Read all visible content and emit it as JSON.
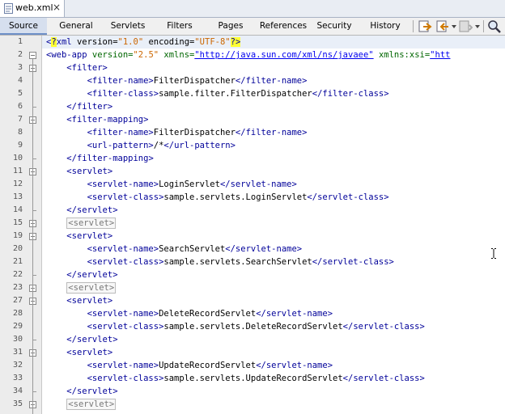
{
  "file_tab": {
    "name": "web.xml",
    "close": "×"
  },
  "view_tabs": [
    "Source",
    "General",
    "Servlets",
    "Filters",
    "Pages",
    "References",
    "Security",
    "History"
  ],
  "active_tab": "Source",
  "toolbar_icons": [
    "back-icon",
    "forward-icon",
    "dropdown-icon",
    "find-icon"
  ],
  "code_lines": [
    {
      "n": "1",
      "s": [
        [
          "t",
          "<"
        ],
        [
          "t y",
          "?"
        ],
        [
          "t",
          "xml"
        ],
        [
          "x",
          " version="
        ],
        [
          "v",
          "\"1.0\""
        ],
        [
          "x",
          " encoding="
        ],
        [
          "v",
          "\"UTF-8\""
        ],
        [
          "t y",
          "?>"
        ]
      ]
    },
    {
      "n": "2",
      "s": [
        [
          "t",
          "<web-app"
        ],
        [
          "a",
          " version="
        ],
        [
          "v",
          "\"2.5\""
        ],
        [
          "a",
          " xmlns="
        ],
        [
          "u",
          "\"http://java.sun.com/xml/ns/javaee\""
        ],
        [
          "a",
          " xmlns:xsi="
        ],
        [
          "u",
          "\"htt"
        ]
      ]
    },
    {
      "n": "3",
      "s": [
        [
          "x",
          "    "
        ],
        [
          "t",
          "<filter>"
        ]
      ]
    },
    {
      "n": "4",
      "s": [
        [
          "x",
          "        "
        ],
        [
          "t",
          "<filter-name>"
        ],
        [
          "x",
          "FilterDispatcher"
        ],
        [
          "t",
          "</filter-name>"
        ]
      ]
    },
    {
      "n": "5",
      "s": [
        [
          "x",
          "        "
        ],
        [
          "t",
          "<filter-class>"
        ],
        [
          "x",
          "sample.filter.FilterDispatcher"
        ],
        [
          "t",
          "</filter-class>"
        ]
      ]
    },
    {
      "n": "6",
      "s": [
        [
          "x",
          "    "
        ],
        [
          "t",
          "</filter>"
        ]
      ]
    },
    {
      "n": "7",
      "s": [
        [
          "x",
          "    "
        ],
        [
          "t",
          "<filter-mapping>"
        ]
      ]
    },
    {
      "n": "8",
      "s": [
        [
          "x",
          "        "
        ],
        [
          "t",
          "<filter-name>"
        ],
        [
          "x",
          "FilterDispatcher"
        ],
        [
          "t",
          "</filter-name>"
        ]
      ]
    },
    {
      "n": "9",
      "s": [
        [
          "x",
          "        "
        ],
        [
          "t",
          "<url-pattern>"
        ],
        [
          "x",
          "/*"
        ],
        [
          "t",
          "</url-pattern>"
        ]
      ]
    },
    {
      "n": "10",
      "s": [
        [
          "x",
          "    "
        ],
        [
          "t",
          "</filter-mapping>"
        ]
      ]
    },
    {
      "n": "11",
      "s": [
        [
          "x",
          "    "
        ],
        [
          "t",
          "<servlet>"
        ]
      ]
    },
    {
      "n": "12",
      "s": [
        [
          "x",
          "        "
        ],
        [
          "t",
          "<servlet-name>"
        ],
        [
          "x",
          "LoginServlet"
        ],
        [
          "t",
          "</servlet-name>"
        ]
      ]
    },
    {
      "n": "13",
      "s": [
        [
          "x",
          "        "
        ],
        [
          "t",
          "<servlet-class>"
        ],
        [
          "x",
          "sample.servlets.LoginServlet"
        ],
        [
          "t",
          "</servlet-class>"
        ]
      ]
    },
    {
      "n": "14",
      "s": [
        [
          "x",
          "    "
        ],
        [
          "t",
          "</servlet>"
        ]
      ]
    },
    {
      "n": "15",
      "s": [
        [
          "x",
          "    "
        ],
        [
          "fb",
          "<servlet>"
        ]
      ]
    },
    {
      "n": "19",
      "s": [
        [
          "x",
          "    "
        ],
        [
          "t",
          "<servlet>"
        ]
      ]
    },
    {
      "n": "20",
      "s": [
        [
          "x",
          "        "
        ],
        [
          "t",
          "<servlet-name>"
        ],
        [
          "x",
          "SearchServlet"
        ],
        [
          "t",
          "</servlet-name>"
        ]
      ]
    },
    {
      "n": "21",
      "s": [
        [
          "x",
          "        "
        ],
        [
          "t",
          "<servlet-class>"
        ],
        [
          "x",
          "sample.servlets.SearchServlet"
        ],
        [
          "t",
          "</servlet-class>"
        ]
      ]
    },
    {
      "n": "22",
      "s": [
        [
          "x",
          "    "
        ],
        [
          "t",
          "</servlet>"
        ]
      ]
    },
    {
      "n": "23",
      "s": [
        [
          "x",
          "    "
        ],
        [
          "fb",
          "<servlet>"
        ]
      ]
    },
    {
      "n": "27",
      "s": [
        [
          "x",
          "    "
        ],
        [
          "t",
          "<servlet>"
        ]
      ]
    },
    {
      "n": "28",
      "s": [
        [
          "x",
          "        "
        ],
        [
          "t",
          "<servlet-name>"
        ],
        [
          "x",
          "DeleteRecordServlet"
        ],
        [
          "t",
          "</servlet-name>"
        ]
      ]
    },
    {
      "n": "29",
      "s": [
        [
          "x",
          "        "
        ],
        [
          "t",
          "<servlet-class>"
        ],
        [
          "x",
          "sample.servlets.DeleteRecordServlet"
        ],
        [
          "t",
          "</servlet-class>"
        ]
      ]
    },
    {
      "n": "30",
      "s": [
        [
          "x",
          "    "
        ],
        [
          "t",
          "</servlet>"
        ]
      ]
    },
    {
      "n": "31",
      "s": [
        [
          "x",
          "    "
        ],
        [
          "t",
          "<servlet>"
        ]
      ]
    },
    {
      "n": "32",
      "s": [
        [
          "x",
          "        "
        ],
        [
          "t",
          "<servlet-name>"
        ],
        [
          "x",
          "UpdateRecordServlet"
        ],
        [
          "t",
          "</servlet-name>"
        ]
      ]
    },
    {
      "n": "33",
      "s": [
        [
          "x",
          "        "
        ],
        [
          "t",
          "<servlet-class>"
        ],
        [
          "x",
          "sample.servlets.UpdateRecordServlet"
        ],
        [
          "t",
          "</servlet-class>"
        ]
      ]
    },
    {
      "n": "34",
      "s": [
        [
          "x",
          "    "
        ],
        [
          "t",
          "</servlet>"
        ]
      ]
    },
    {
      "n": "35",
      "s": [
        [
          "x",
          "    "
        ],
        [
          "fb",
          "<servlet>"
        ]
      ]
    }
  ],
  "folds": [
    {
      "line": "2",
      "type": "minus"
    },
    {
      "line": "3",
      "type": "minus"
    },
    {
      "line": "6",
      "type": "end"
    },
    {
      "line": "7",
      "type": "minus"
    },
    {
      "line": "10",
      "type": "end"
    },
    {
      "line": "11",
      "type": "minus"
    },
    {
      "line": "14",
      "type": "end"
    },
    {
      "line": "15",
      "type": "plus"
    },
    {
      "line": "19",
      "type": "minus"
    },
    {
      "line": "22",
      "type": "end"
    },
    {
      "line": "23",
      "type": "plus"
    },
    {
      "line": "27",
      "type": "minus"
    },
    {
      "line": "30",
      "type": "end"
    },
    {
      "line": "31",
      "type": "minus"
    },
    {
      "line": "34",
      "type": "end"
    },
    {
      "line": "35",
      "type": "plus"
    }
  ],
  "colors": {
    "tag": "#000099",
    "attr": "#006600",
    "value": "#cc6600",
    "link": "#0000ee",
    "highlight": "#ffff33"
  }
}
